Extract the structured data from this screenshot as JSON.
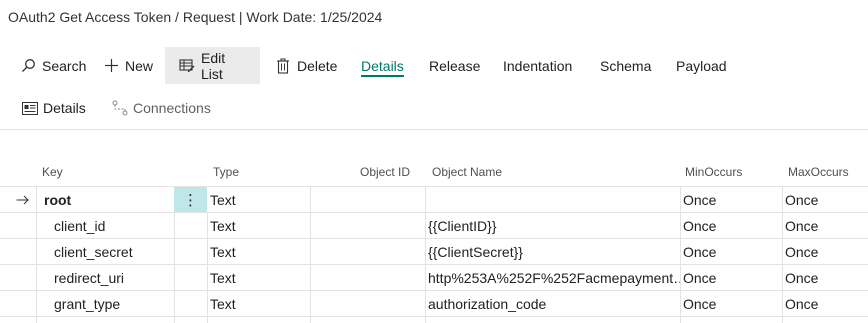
{
  "window": {
    "title": "OAuth2 Get Access Token / Request | Work Date: 1/25/2024"
  },
  "toolbar": {
    "search": "Search",
    "new": "New",
    "edit_list": "Edit List",
    "delete": "Delete",
    "details": "Details",
    "release": "Release",
    "indentation": "Indentation",
    "schema": "Schema",
    "payload": "Payload"
  },
  "toolbar2": {
    "details": "Details",
    "connections": "Connections"
  },
  "grid": {
    "columns": [
      "Key",
      "Type",
      "Object ID",
      "Object Name",
      "MinOccurs",
      "MaxOccurs"
    ],
    "rows": [
      {
        "key": "root",
        "type": "Text",
        "object_id": "",
        "object_name": "",
        "min": "Once",
        "max": "Once"
      },
      {
        "key": "client_id",
        "type": "Text",
        "object_id": "",
        "object_name": "{{ClientID}}",
        "min": "Once",
        "max": "Once"
      },
      {
        "key": "client_secret",
        "type": "Text",
        "object_id": "",
        "object_name": "{{ClientSecret}}",
        "min": "Once",
        "max": "Once"
      },
      {
        "key": "redirect_uri",
        "type": "Text",
        "object_id": "",
        "object_name": "http%253A%252F%252Facmepayment…",
        "min": "Once",
        "max": "Once"
      },
      {
        "key": "grant_type",
        "type": "Text",
        "object_id": "",
        "object_name": "authorization_code",
        "min": "Once",
        "max": "Once"
      }
    ]
  },
  "colors": {
    "accent": "#00796b",
    "selected_cell": "#bfe6e8",
    "active_button_bg": "#ebebeb"
  }
}
